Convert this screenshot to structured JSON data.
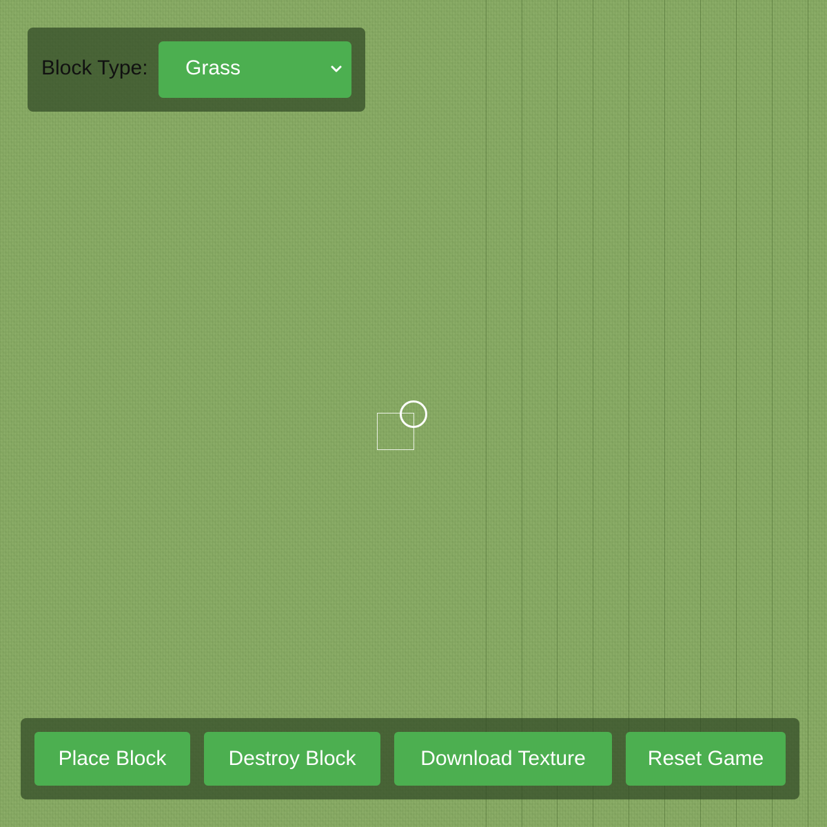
{
  "toolbar": {
    "block_type_label": "Block Type:",
    "block_type_selected": "Grass"
  },
  "actions": {
    "place_block": "Place Block",
    "destroy_block": "Destroy Block",
    "download_texture": "Download Texture",
    "reset_game": "Reset Game"
  },
  "colors": {
    "button_green": "#4caf50",
    "grass_green": "#86a863",
    "panel_overlay": "#2d4623"
  },
  "icons": {
    "select_arrow": "chevron-down-icon",
    "crosshair": "crosshair-icon"
  }
}
